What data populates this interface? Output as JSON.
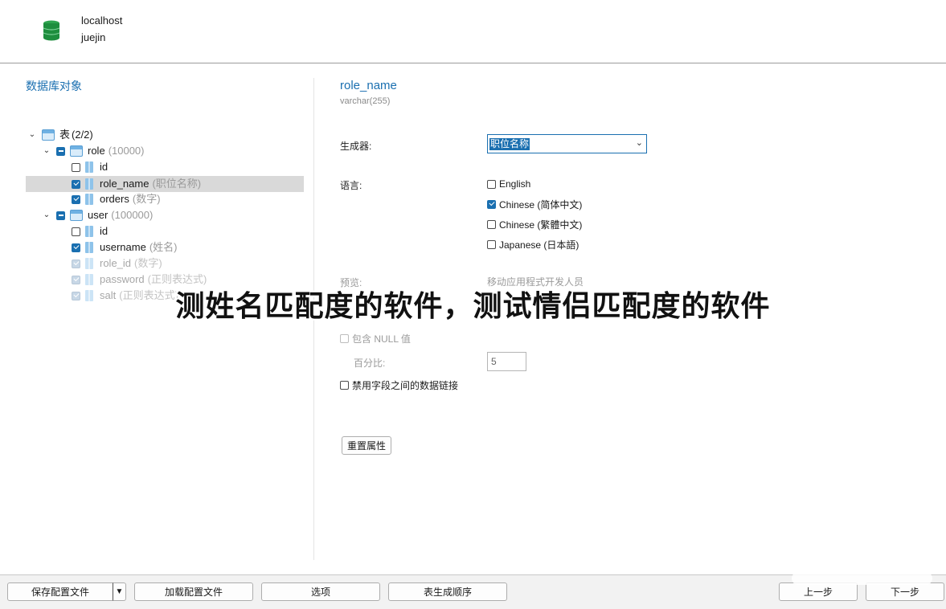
{
  "connection": {
    "host": "localhost",
    "database": "juejin"
  },
  "left_panel": {
    "title": "数据库对象",
    "tree": {
      "root_label": "表",
      "root_count": "(2/2)",
      "role_table": {
        "name": "role",
        "rows": "(10000)",
        "columns": [
          {
            "name": "id",
            "hint": ""
          },
          {
            "name": "role_name",
            "hint": "(职位名称)"
          },
          {
            "name": "orders",
            "hint": "(数字)"
          }
        ]
      },
      "user_table": {
        "name": "user",
        "rows": "(100000)",
        "columns": [
          {
            "name": "id",
            "hint": ""
          },
          {
            "name": "username",
            "hint": "(姓名)"
          },
          {
            "name": "role_id",
            "hint": "(数字)"
          },
          {
            "name": "password",
            "hint": "(正则表达式)"
          },
          {
            "name": "salt",
            "hint": "(正则表达式)"
          }
        ]
      }
    }
  },
  "right_panel": {
    "field_name": "role_name",
    "field_type": "varchar(255)",
    "generator_label": "生成器:",
    "generator_value": "职位名称",
    "language_label": "语言:",
    "languages": [
      "English",
      "Chinese (简体中文)",
      "Chinese (繁體中文)",
      "Japanese (日本語)"
    ],
    "preview_label": "预览:",
    "preview_value": "移动应用程式开发人员",
    "include_null_label": "包含 NULL 值",
    "percent_label": "百分比:",
    "percent_value": "5",
    "disable_link_label": "禁用字段之间的数据链接",
    "reset_button": "重置属性"
  },
  "overlay_text": "测姓名匹配度的软件，测试情侣匹配度的软件",
  "footer": {
    "save_config": "保存配置文件",
    "load_config": "加载配置文件",
    "options": "选项",
    "table_order": "表生成顺序",
    "prev": "上一步",
    "next": "下一步"
  }
}
